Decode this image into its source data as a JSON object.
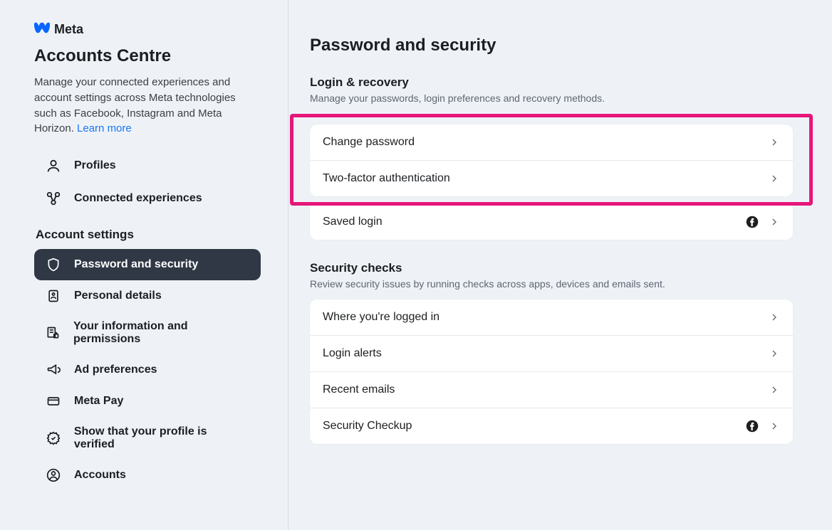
{
  "brand": "Meta",
  "sidebar": {
    "title": "Accounts Centre",
    "desc": "Manage your connected experiences and account settings across Meta technologies such as Facebook, Instagram and Meta Horizon. ",
    "learn_more": "Learn more",
    "top_items": [
      {
        "label": "Profiles"
      },
      {
        "label": "Connected experiences"
      }
    ],
    "section_label": "Account settings",
    "settings_items": [
      {
        "label": "Password and security",
        "active": true
      },
      {
        "label": "Personal details"
      },
      {
        "label": "Your information and permissions"
      },
      {
        "label": "Ad preferences"
      },
      {
        "label": "Meta Pay"
      },
      {
        "label": "Show that your profile is verified"
      },
      {
        "label": "Accounts"
      }
    ]
  },
  "main": {
    "title": "Password and security",
    "group1": {
      "title": "Login & recovery",
      "sub": "Manage your passwords, login preferences and recovery methods.",
      "rows": [
        {
          "label": "Change password",
          "fb": false
        },
        {
          "label": "Two-factor authentication",
          "fb": false
        },
        {
          "label": "Saved login",
          "fb": true
        }
      ]
    },
    "group2": {
      "title": "Security checks",
      "sub": "Review security issues by running checks across apps, devices and emails sent.",
      "rows": [
        {
          "label": "Where you're logged in",
          "fb": false
        },
        {
          "label": "Login alerts",
          "fb": false
        },
        {
          "label": "Recent emails",
          "fb": false
        },
        {
          "label": "Security Checkup",
          "fb": true
        }
      ]
    }
  }
}
